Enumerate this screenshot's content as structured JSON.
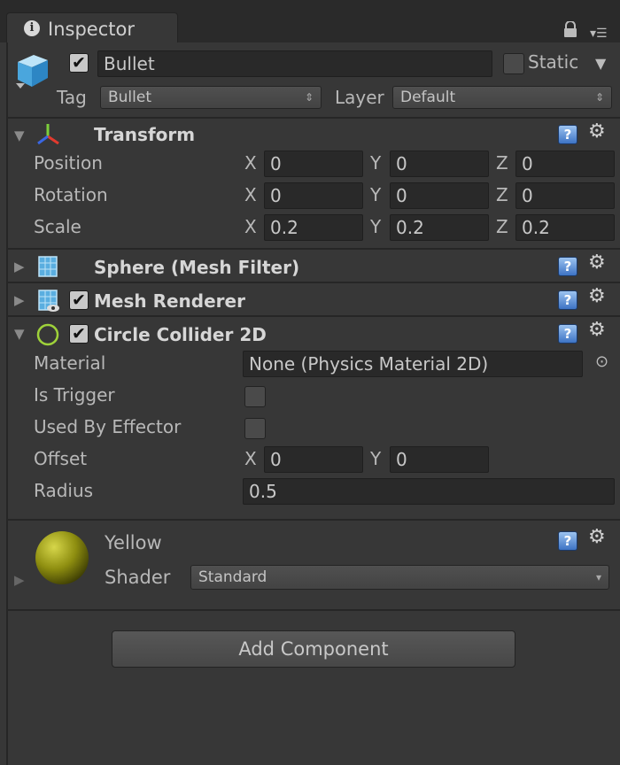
{
  "window": {
    "tab_label": "Inspector"
  },
  "gameobject": {
    "active": true,
    "name": "Bullet",
    "static_label": "Static",
    "tag_label": "Tag",
    "tag_value": "Bullet",
    "layer_label": "Layer",
    "layer_value": "Default"
  },
  "transform": {
    "title": "Transform",
    "position": {
      "label": "Position",
      "x": "0",
      "y": "0",
      "z": "0"
    },
    "rotation": {
      "label": "Rotation",
      "x": "0",
      "y": "0",
      "z": "0"
    },
    "scale": {
      "label": "Scale",
      "x": "0.2",
      "y": "0.2",
      "z": "0.2"
    },
    "axis_x": "X",
    "axis_y": "Y",
    "axis_z": "Z"
  },
  "mesh_filter": {
    "title": "Sphere (Mesh Filter)"
  },
  "mesh_renderer": {
    "title": "Mesh Renderer",
    "enabled": true
  },
  "circle_collider": {
    "title": "Circle Collider 2D",
    "enabled": true,
    "material_label": "Material",
    "material_value": "None (Physics Material 2D)",
    "is_trigger_label": "Is Trigger",
    "used_by_effector_label": "Used By Effector",
    "offset_label": "Offset",
    "offset_x": "0",
    "offset_y": "0",
    "radius_label": "Radius",
    "radius_value": "0.5"
  },
  "material": {
    "name": "Yellow",
    "shader_label": "Shader",
    "shader_value": "Standard",
    "preview_color": "#9a9a14"
  },
  "add_component_label": "Add Component",
  "icons": [
    "info-icon",
    "lock-icon",
    "menu-icon",
    "cube-icon",
    "transform-icon",
    "mesh-filter-icon",
    "mesh-renderer-icon",
    "circle-collider-icon",
    "help-icon",
    "gear-icon",
    "object-picker-icon",
    "sphere-preview-icon"
  ]
}
